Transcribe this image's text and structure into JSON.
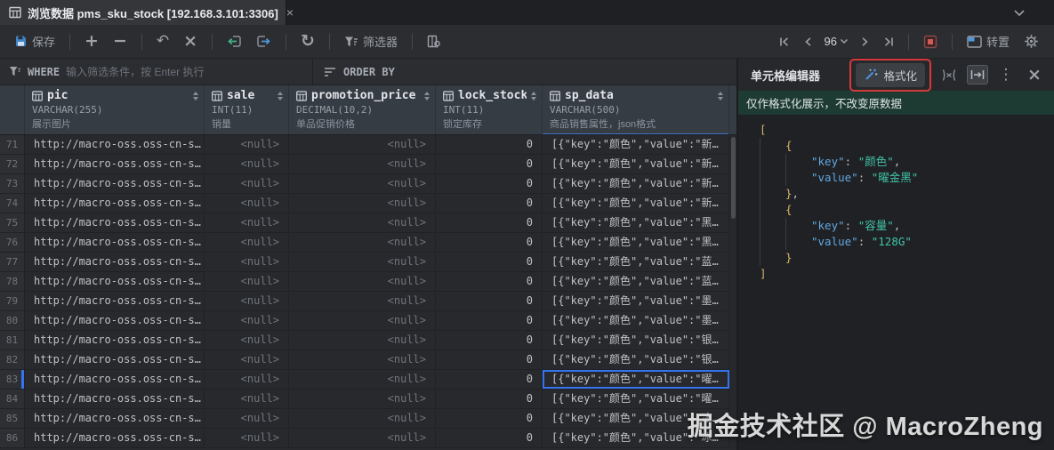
{
  "tab": {
    "title": "浏览数据 pms_sku_stock [192.168.3.101:3306]"
  },
  "icons": {
    "plus": "+",
    "minus": "−",
    "undo": "↶",
    "cancel": "×",
    "refresh": "↻",
    "more_dots": "⋮",
    "close": "×",
    "tab_close": "×"
  },
  "toolbar": {
    "save_label": "保存",
    "filter_label": "筛选器",
    "page_size": "96",
    "transpose_label": "转置"
  },
  "filter": {
    "where_label": "WHERE",
    "where_placeholder": "输入筛选条件，按 Enter 执行",
    "orderby_label": "ORDER BY"
  },
  "table": {
    "columns": [
      {
        "name": "pic",
        "type": "VARCHAR(255)",
        "comment": "展示图片",
        "align": "left",
        "selected": false
      },
      {
        "name": "sale",
        "type": "INT(11)",
        "comment": "销量",
        "align": "right",
        "selected": false
      },
      {
        "name": "promotion_price",
        "type": "DECIMAL(10,2)",
        "comment": "单品促销价格",
        "align": "right",
        "selected": false
      },
      {
        "name": "lock_stock",
        "type": "INT(11)",
        "comment": "锁定库存",
        "align": "right",
        "selected": false
      },
      {
        "name": "sp_data",
        "type": "VARCHAR(500)",
        "comment": "商品销售属性，json格式",
        "align": "left",
        "selected": true
      }
    ],
    "selected_row": 83,
    "selected_column": "sp_data",
    "rows": [
      {
        "num": 71,
        "pic": "http://macro-oss.oss-cn-s…",
        "sale": "<null>",
        "promotion_price": "<null>",
        "lock_stock": "0",
        "sp_data": "[{\"key\":\"颜色\",\"value\":\"新…"
      },
      {
        "num": 72,
        "pic": "http://macro-oss.oss-cn-s…",
        "sale": "<null>",
        "promotion_price": "<null>",
        "lock_stock": "0",
        "sp_data": "[{\"key\":\"颜色\",\"value\":\"新…"
      },
      {
        "num": 73,
        "pic": "http://macro-oss.oss-cn-s…",
        "sale": "<null>",
        "promotion_price": "<null>",
        "lock_stock": "0",
        "sp_data": "[{\"key\":\"颜色\",\"value\":\"新…"
      },
      {
        "num": 74,
        "pic": "http://macro-oss.oss-cn-s…",
        "sale": "<null>",
        "promotion_price": "<null>",
        "lock_stock": "0",
        "sp_data": "[{\"key\":\"颜色\",\"value\":\"新…"
      },
      {
        "num": 75,
        "pic": "http://macro-oss.oss-cn-s…",
        "sale": "<null>",
        "promotion_price": "<null>",
        "lock_stock": "0",
        "sp_data": "[{\"key\":\"颜色\",\"value\":\"黑…"
      },
      {
        "num": 76,
        "pic": "http://macro-oss.oss-cn-s…",
        "sale": "<null>",
        "promotion_price": "<null>",
        "lock_stock": "0",
        "sp_data": "[{\"key\":\"颜色\",\"value\":\"黑…"
      },
      {
        "num": 77,
        "pic": "http://macro-oss.oss-cn-s…",
        "sale": "<null>",
        "promotion_price": "<null>",
        "lock_stock": "0",
        "sp_data": "[{\"key\":\"颜色\",\"value\":\"蓝…"
      },
      {
        "num": 78,
        "pic": "http://macro-oss.oss-cn-s…",
        "sale": "<null>",
        "promotion_price": "<null>",
        "lock_stock": "0",
        "sp_data": "[{\"key\":\"颜色\",\"value\":\"蓝…"
      },
      {
        "num": 79,
        "pic": "http://macro-oss.oss-cn-s…",
        "sale": "<null>",
        "promotion_price": "<null>",
        "lock_stock": "0",
        "sp_data": "[{\"key\":\"颜色\",\"value\":\"墨…"
      },
      {
        "num": 80,
        "pic": "http://macro-oss.oss-cn-s…",
        "sale": "<null>",
        "promotion_price": "<null>",
        "lock_stock": "0",
        "sp_data": "[{\"key\":\"颜色\",\"value\":\"墨…"
      },
      {
        "num": 81,
        "pic": "http://macro-oss.oss-cn-s…",
        "sale": "<null>",
        "promotion_price": "<null>",
        "lock_stock": "0",
        "sp_data": "[{\"key\":\"颜色\",\"value\":\"银…"
      },
      {
        "num": 82,
        "pic": "http://macro-oss.oss-cn-s…",
        "sale": "<null>",
        "promotion_price": "<null>",
        "lock_stock": "0",
        "sp_data": "[{\"key\":\"颜色\",\"value\":\"银…"
      },
      {
        "num": 83,
        "pic": "http://macro-oss.oss-cn-s…",
        "sale": "<null>",
        "promotion_price": "<null>",
        "lock_stock": "0",
        "sp_data": "[{\"key\":\"颜色\",\"value\":\"曜…"
      },
      {
        "num": 84,
        "pic": "http://macro-oss.oss-cn-s…",
        "sale": "<null>",
        "promotion_price": "<null>",
        "lock_stock": "0",
        "sp_data": "[{\"key\":\"颜色\",\"value\":\"曜…"
      },
      {
        "num": 85,
        "pic": "http://macro-oss.oss-cn-s…",
        "sale": "<null>",
        "promotion_price": "<null>",
        "lock_stock": "0",
        "sp_data": "[{\"key\":\"颜色\",\"value\":\"冰…"
      },
      {
        "num": 86,
        "pic": "http://macro-oss.oss-cn-s…",
        "sale": "<null>",
        "promotion_price": "<null>",
        "lock_stock": "0",
        "sp_data": "[{\"key\":\"颜色\",\"value\":\"冰…"
      }
    ]
  },
  "panel": {
    "title": "单元格编辑器",
    "format_label": "格式化",
    "notice": "仅作格式化展示，不改变原数据",
    "code_lines": [
      {
        "g": 0,
        "tokens": [
          [
            "br",
            "["
          ]
        ]
      },
      {
        "g": 1,
        "tokens": [
          [
            "br",
            "{"
          ]
        ]
      },
      {
        "g": 2,
        "tokens": [
          [
            "key",
            "\"key\""
          ],
          [
            "pn",
            ": "
          ],
          [
            "str",
            "\"颜色\""
          ],
          [
            "pn",
            ","
          ]
        ]
      },
      {
        "g": 2,
        "tokens": [
          [
            "key",
            "\"value\""
          ],
          [
            "pn",
            ": "
          ],
          [
            "str",
            "\"曜金黑\""
          ]
        ]
      },
      {
        "g": 1,
        "tokens": [
          [
            "br",
            "}"
          ],
          [
            "pn",
            ","
          ]
        ]
      },
      {
        "g": 1,
        "tokens": [
          [
            "br",
            "{"
          ]
        ]
      },
      {
        "g": 2,
        "tokens": [
          [
            "key",
            "\"key\""
          ],
          [
            "pn",
            ": "
          ],
          [
            "str",
            "\"容量\""
          ],
          [
            "pn",
            ","
          ]
        ]
      },
      {
        "g": 2,
        "tokens": [
          [
            "key",
            "\"value\""
          ],
          [
            "pn",
            ": "
          ],
          [
            "str",
            "\"128G\""
          ]
        ]
      },
      {
        "g": 1,
        "tokens": [
          [
            "br",
            "}"
          ]
        ]
      },
      {
        "g": 0,
        "tokens": [
          [
            "br",
            "]"
          ]
        ]
      }
    ]
  },
  "watermark": "掘金技术社区 @ MacroZheng",
  "colors": {
    "accent_blue": "#3574f0",
    "selected_column_underline": "#3f74c8",
    "annotation_red": "#d53a3a",
    "notice_green_bg": "#1e3b33",
    "json_bracket": "#d5b26a",
    "json_key": "#61a8e0",
    "json_string": "#41c3a9",
    "save_icon_blue": "#4285c9",
    "import_icon_green": "#43b58a",
    "export_icon_blue": "#4d9ae0"
  }
}
